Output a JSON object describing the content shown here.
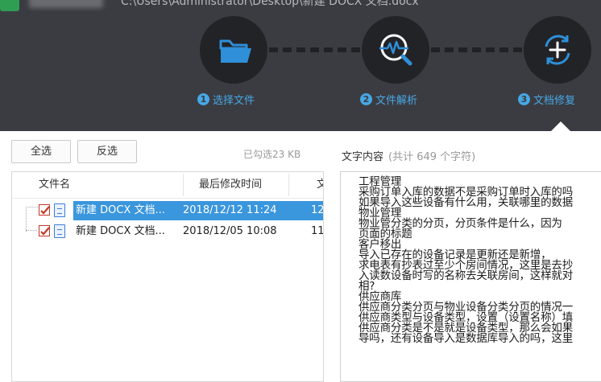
{
  "window": {
    "title_path": "C:\\Users\\Administrator\\Desktop\\新建 DOCX 文档.docx"
  },
  "steps": [
    {
      "number": "1",
      "label": "选择文件",
      "icon": "folder-icon"
    },
    {
      "number": "2",
      "label": "文件解析",
      "icon": "analyze-icon"
    },
    {
      "number": "3",
      "label": "文档修复",
      "icon": "repair-icon"
    }
  ],
  "toolbar": {
    "select_all": "全选",
    "invert_select": "反选",
    "selected_size": "已勾选23 KB"
  },
  "file_list": {
    "columns": [
      "文件名",
      "最后修改时间",
      "文"
    ],
    "rows": [
      {
        "name": "新建 DOCX 文档...",
        "modified": "2018/12/12 11:24",
        "extra": "12",
        "checked": true,
        "selected": true
      },
      {
        "name": "新建 DOCX 文档...",
        "modified": "2018/12/05 10:08",
        "extra": "11",
        "checked": true,
        "selected": false
      }
    ]
  },
  "content": {
    "title": "文字内容",
    "char_count": "(共计 649 个字符)",
    "text": "工程管理\n采购订单入库的数据不是采购订单时入库的吗\n如果导入这些设备有什么用，关联哪里的数据\n物业管理\n物业管分类的分页，分页条件是什么，因为\n页面的标题\n客户移出\n导入已存在的设备记录是更新还是新增，\n求电表有抄表过至少个房间情况，这里是去抄\n入读数设备时写的名称去关联房间，这样就对\n相?\n供应商库\n供应商分类分页与物业设备分类分页的情况一\n供应商类型与设备类型，设置（设置名称）填\n供应商分类是不是就是设备类型，那么会如果\n导吗，还有设备导入是数据库导入的吗，这里"
  },
  "colors": {
    "header_bg": "#3b3c42",
    "step_circle": "#222327",
    "accent": "#47a8e6",
    "selection": "#3a96dd",
    "checkbox": "#c0392b"
  }
}
